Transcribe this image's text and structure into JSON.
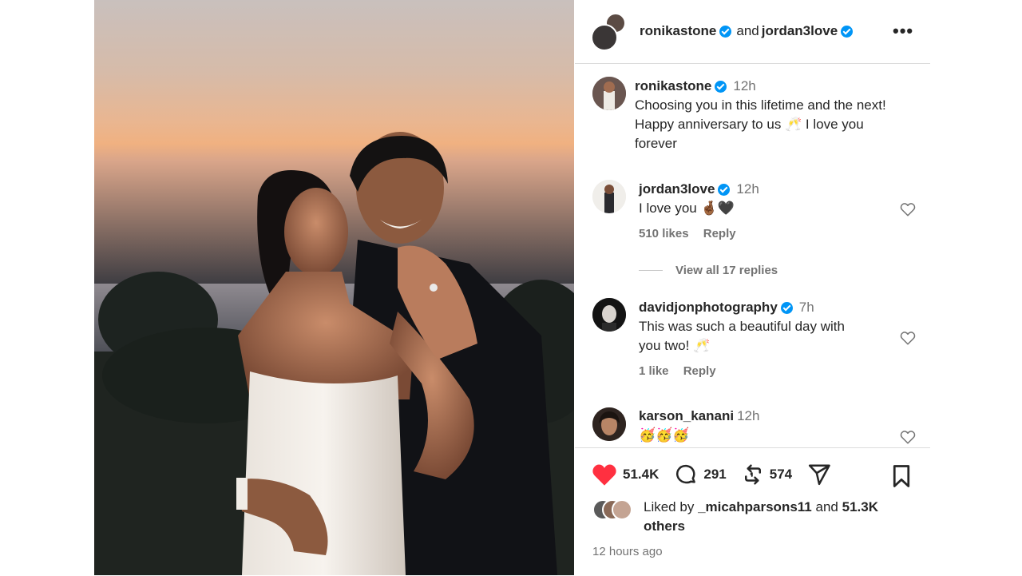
{
  "post": {
    "image_alt": "Couple posing at sunset showing engagement ring",
    "next_icon": "chevron-right-icon"
  },
  "header": {
    "user1": "ronikastone",
    "and_text": "and",
    "user2": "jordan3love",
    "more_icon": "more-horizontal-icon"
  },
  "caption": {
    "username": "ronikastone",
    "time": "12h",
    "text_line1": "Choosing you in this lifetime and the next!",
    "text_line2": "Happy anniversary to us 🥂 I love you",
    "text_line3": "forever"
  },
  "comments": [
    {
      "username": "jordan3love",
      "verified": true,
      "time": "12h",
      "text": "I love you 🤞🏾🖤",
      "likes": "510 likes",
      "reply": "Reply"
    },
    {
      "username": "davidjonphotography",
      "verified": true,
      "time": "7h",
      "text_line1": "This was such a beautiful day with",
      "text_line2": "you two! 🥂",
      "likes": "1 like",
      "reply": "Reply"
    },
    {
      "username": "karson_kanani",
      "verified": false,
      "time": "12h",
      "text": "🥳🥳🥳"
    }
  ],
  "view_replies": "View all 17 replies",
  "actions": {
    "likes_count": "51.4K",
    "comments_count": "291",
    "reposts_count": "574"
  },
  "liked_by": {
    "prefix": "Liked by",
    "user": "_micahparsons11",
    "and_text": "and",
    "others_count": "51.3K",
    "others_word": "others"
  },
  "timestamp": "12 hours ago",
  "colors": {
    "verified": "#0095f6",
    "like_red": "#ff3040",
    "text": "#262626",
    "muted": "#737373"
  }
}
